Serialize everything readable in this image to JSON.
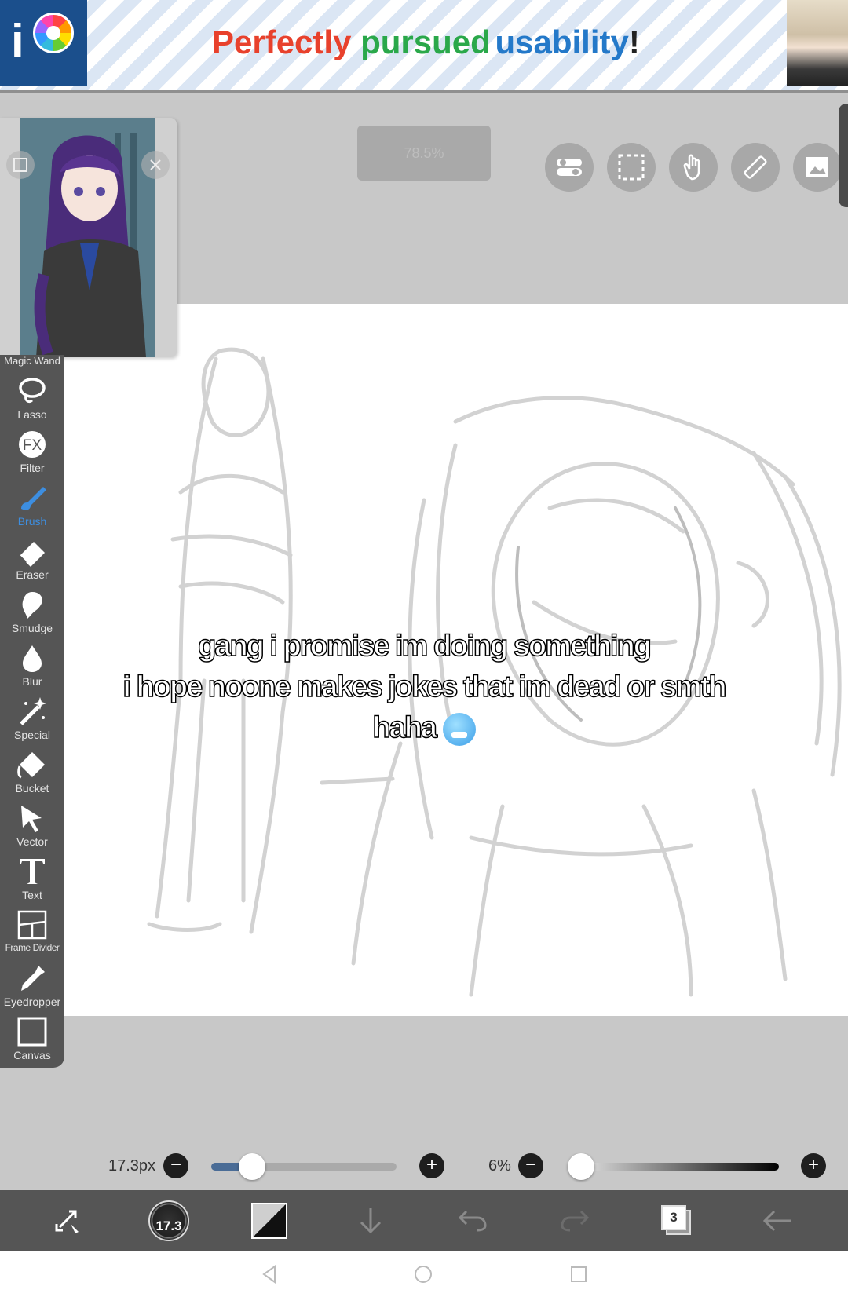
{
  "ad": {
    "word1": "Perfectly",
    "word2": "pursued",
    "word3": "usability",
    "exclaim": "!",
    "logo_text": "i",
    "colors": {
      "word1": "#e8412c",
      "word2": "#2aa84a",
      "word3": "#2479c9",
      "exclaim": "#222222"
    }
  },
  "top": {
    "zoom": "78.5%",
    "buttons": [
      "toggle-icon",
      "selection-icon",
      "hand-icon",
      "ruler-icon",
      "image-icon"
    ]
  },
  "tools": [
    {
      "label": "Magic Wand",
      "icon": "magic-wand-icon"
    },
    {
      "label": "Lasso",
      "icon": "lasso-icon"
    },
    {
      "label": "Filter",
      "icon": "fx-icon"
    },
    {
      "label": "Brush",
      "icon": "brush-icon",
      "active": true
    },
    {
      "label": "Eraser",
      "icon": "eraser-icon"
    },
    {
      "label": "Smudge",
      "icon": "smudge-icon"
    },
    {
      "label": "Blur",
      "icon": "blur-drop-icon"
    },
    {
      "label": "Special",
      "icon": "special-sparkle-icon"
    },
    {
      "label": "Bucket",
      "icon": "bucket-icon"
    },
    {
      "label": "Vector",
      "icon": "vector-arrow-icon"
    },
    {
      "label": "Text",
      "icon": "text-icon"
    },
    {
      "label": "Frame Divider",
      "icon": "frame-divider-icon"
    },
    {
      "label": "Eyedropper",
      "icon": "eyedropper-icon"
    },
    {
      "label": "Canvas",
      "icon": "canvas-icon"
    }
  ],
  "caption": {
    "line1": "gang i promise im doing something",
    "line2": "i hope noone makes jokes that im dead or smth",
    "line3": "haha",
    "emoji": "cold-face-emoji"
  },
  "brush": {
    "size_label": "17.3px",
    "size_fraction": 0.22,
    "opacity_label": "6%",
    "opacity_fraction": 0.06
  },
  "bottom": {
    "brush_size_badge": "17.3",
    "layer_count": "3",
    "buttons": [
      "transform-icon",
      "brush-size-icon",
      "color-swatch-icon",
      "download-icon",
      "undo-icon",
      "redo-icon",
      "layers-icon",
      "back-arrow-icon"
    ]
  },
  "colors": {
    "accent": "#3d8ee0",
    "toolbar": "#555555",
    "canvas": "#ffffff",
    "workspace": "#c8c8c8"
  }
}
